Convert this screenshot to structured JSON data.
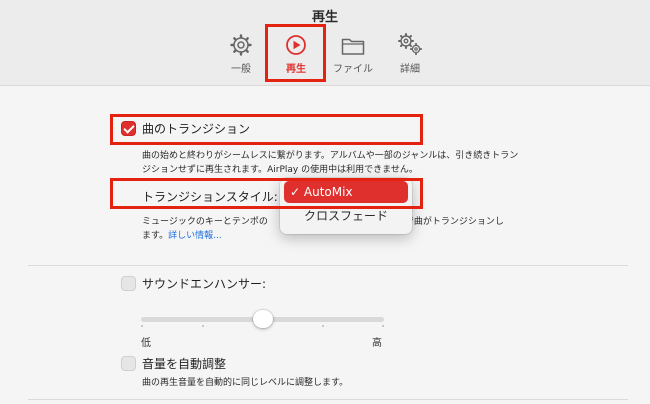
{
  "window": {
    "title": "再生"
  },
  "tabs": [
    {
      "label": "一般",
      "icon": "gear-icon"
    },
    {
      "label": "再生",
      "icon": "play-circle-icon"
    },
    {
      "label": "ファイル",
      "icon": "folder-icon"
    },
    {
      "label": "詳細",
      "icon": "gears-icon"
    }
  ],
  "crossfade": {
    "label": "曲のトランジション",
    "checked": true,
    "description_line1": "曲の始めと終わりがシームレスに繋がります。アルバムや一部のジャンルは、引き続きトラン",
    "description_line2": "ジションせずに再生されます。AirPlay の使用中は利用できません。"
  },
  "transition_style": {
    "label": "トランジションスタイル:",
    "options": [
      "AutoMix",
      "クロスフェード"
    ],
    "selected": "AutoMix",
    "checkmark": "✓",
    "description_line1_start": "ミュージックのキーとテンポの",
    "description_line1_end": "ミングで曲がトランジションし",
    "description_line2_start": "ます。",
    "more_info_link": "詳しい情報..."
  },
  "sound_enhancer": {
    "label": "サウンドエンハンサー:",
    "checked": false,
    "level": 0.5,
    "low_label": "低",
    "high_label": "高"
  },
  "sound_check": {
    "label": "音量を自動調整",
    "checked": false,
    "description": "曲の再生音量を自動的に同じレベルに調整します。"
  },
  "colors": {
    "accent": "#e0302e",
    "highlight_box": "#e3230f"
  }
}
